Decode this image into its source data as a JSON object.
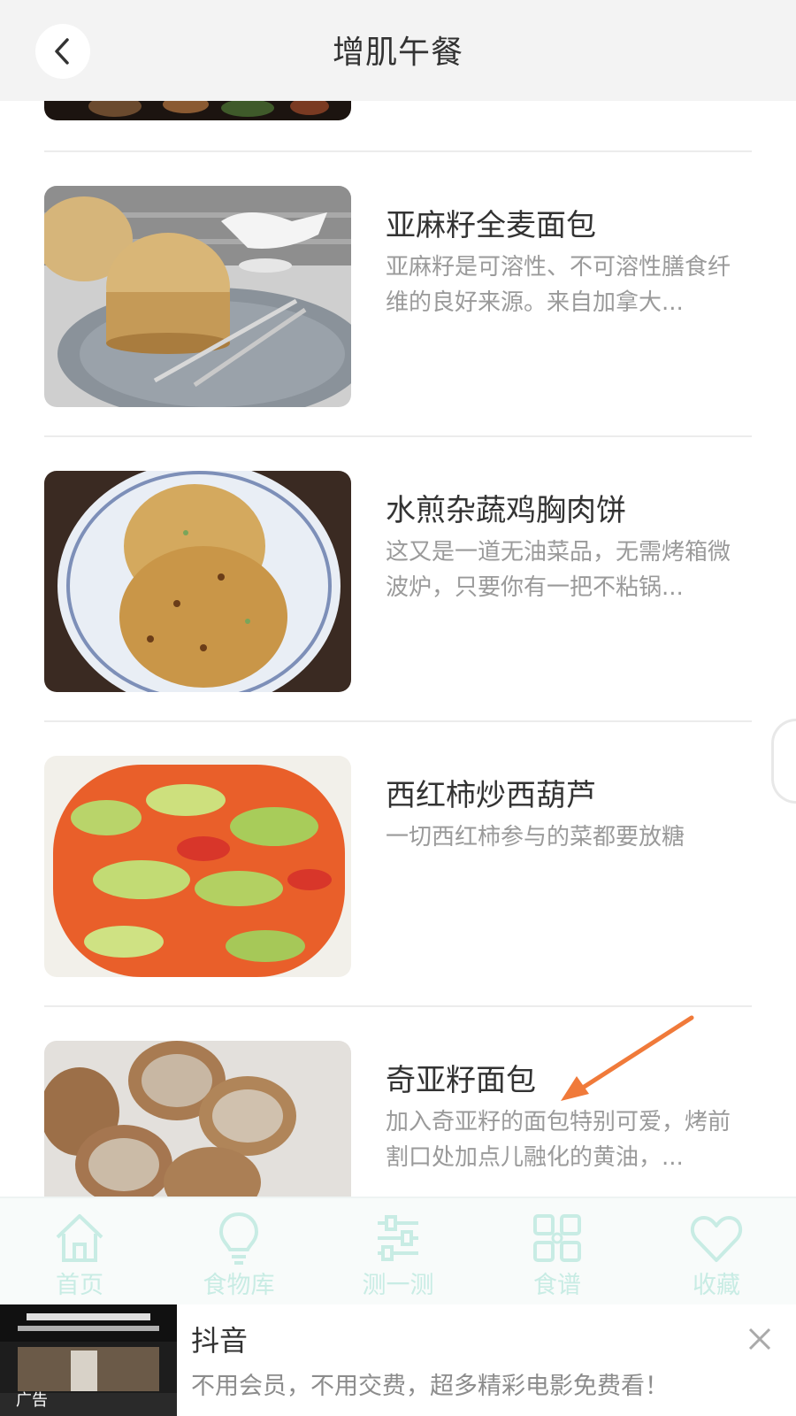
{
  "header": {
    "title": "增肌午餐"
  },
  "recipes": [
    {
      "title": "亚麻籽全麦面包",
      "description": "亚麻籽是可溶性、不可溶性膳食纤维的良好来源。来自加拿大..."
    },
    {
      "title": "水煎杂蔬鸡胸肉饼",
      "description": "这又是一道无油菜品，无需烤箱微波炉，只要你有一把不粘锅..."
    },
    {
      "title": "西红柿炒西葫芦",
      "description": "一切西红柿参与的菜都要放糖"
    },
    {
      "title": "奇亚籽面包",
      "description": "加入奇亚籽的面包特别可爱，烤前割口处加点儿融化的黄油，..."
    }
  ],
  "tabbar": {
    "items": [
      {
        "label": "首页",
        "icon": "home-icon"
      },
      {
        "label": "食物库",
        "icon": "lightbulb-icon"
      },
      {
        "label": "测一测",
        "icon": "sliders-icon"
      },
      {
        "label": "食谱",
        "icon": "grid-icon"
      },
      {
        "label": "收藏",
        "icon": "heart-icon"
      }
    ]
  },
  "ad": {
    "title": "抖音",
    "description": "不用会员，不用交费，超多精彩电影免费看！",
    "label": "广告"
  },
  "colors": {
    "header_bg": "#f3f3f3",
    "tab_inactive": "#c8ece4",
    "annotation_arrow": "#f07a3a"
  }
}
